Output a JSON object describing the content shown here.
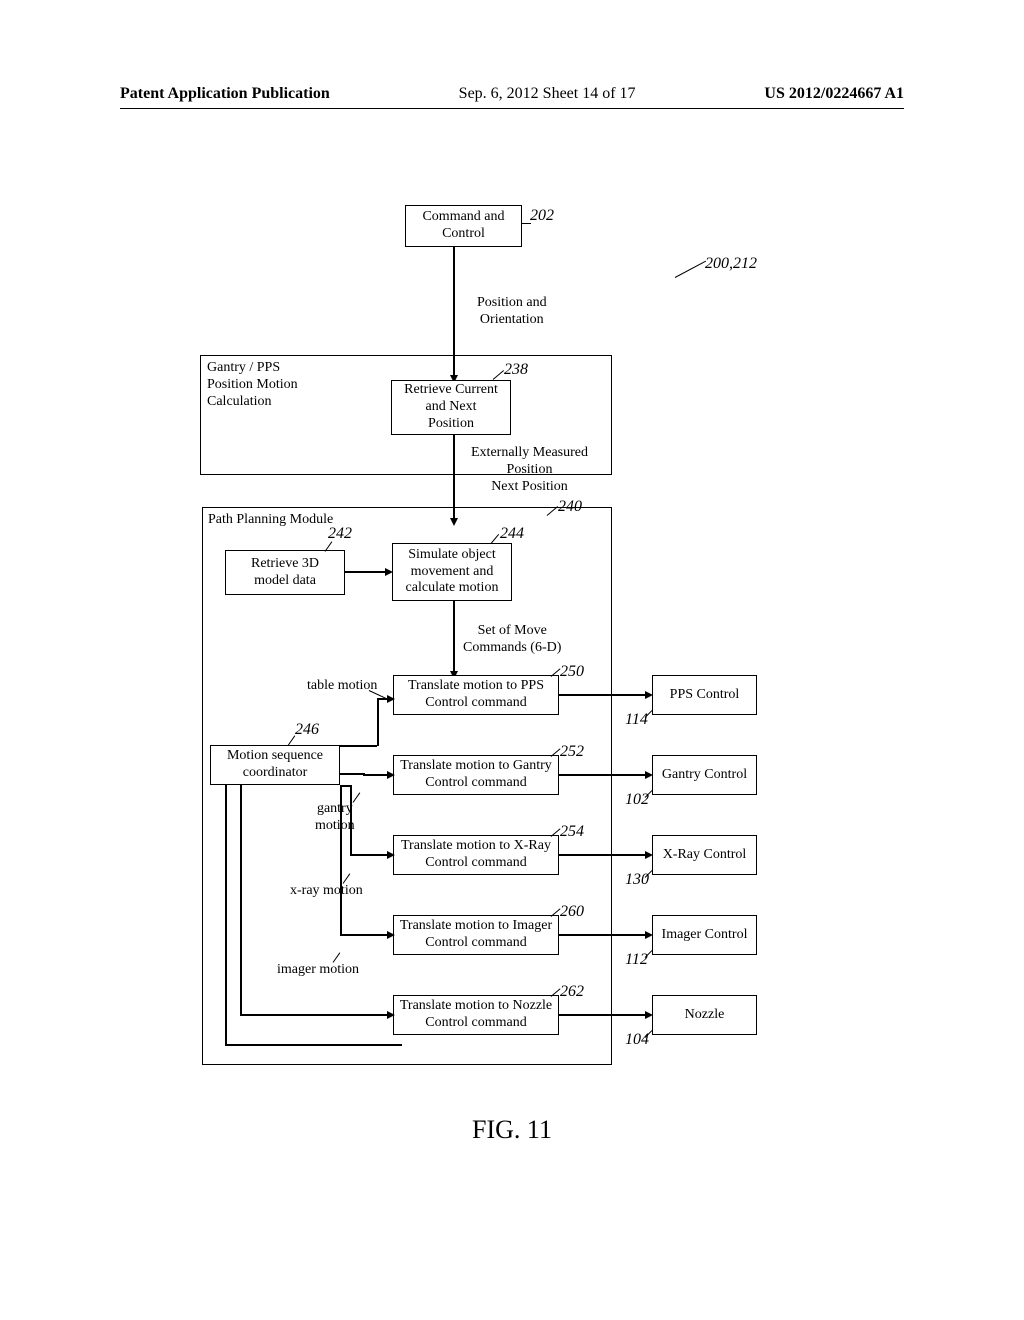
{
  "header": {
    "left": "Patent Application Publication",
    "center": "Sep. 6, 2012  Sheet 14 of 17",
    "right": "US 2012/0224667 A1"
  },
  "boxes": {
    "command_control": "Command and\nControl",
    "retrieve_current": "Retrieve Current\nand Next\nPosition",
    "retrieve_3d": "Retrieve 3D\nmodel data",
    "simulate": "Simulate object\nmovement and\ncalculate motion",
    "motion_coord": "Motion sequence\ncoordinator",
    "translate_pps": "Translate motion to PPS\nControl command",
    "translate_gantry": "Translate motion to Gantry\nControl command",
    "translate_xray": "Translate motion to X-Ray\nControl command",
    "translate_imager": "Translate motion to Imager\nControl command",
    "translate_nozzle": "Translate motion to Nozzle\nControl command",
    "pps_control": "PPS Control",
    "gantry_control": "Gantry Control",
    "xray_control": "X-Ray Control",
    "imager_control": "Imager Control",
    "nozzle": "Nozzle"
  },
  "labels": {
    "gantry_pps_calc": "Gantry / PPS\nPosition Motion\nCalculation",
    "path_planning": "Path Planning Module",
    "position_orient": "Position and\nOrientation",
    "ext_measured": "Externally Measured\nPosition\nNext Position",
    "set_move": "Set of Move\nCommands (6-D)",
    "table_motion": "table motion",
    "gantry_motion": "gantry\nmotion",
    "xray_motion": "x-ray motion",
    "imager_motion": "imager motion"
  },
  "refs": {
    "r202": "202",
    "r200_212": "200,212",
    "r238": "238",
    "r240": "240",
    "r242": "242",
    "r244": "244",
    "r246": "246",
    "r250": "250",
    "r252": "252",
    "r254": "254",
    "r260": "260",
    "r262": "262",
    "r114": "114",
    "r102": "102",
    "r130": "130",
    "r112": "112",
    "r104": "104"
  },
  "figure_caption": "FIG. 11"
}
